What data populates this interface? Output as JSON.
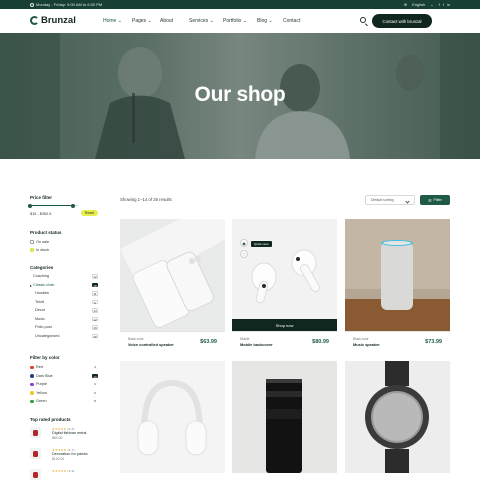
{
  "topbar": {
    "hours": "Monday - Friday: 9:00 AM to 6:00 PM",
    "language": "English",
    "social": [
      "f",
      "t",
      "in"
    ]
  },
  "header": {
    "logo": "Brunzal",
    "nav": [
      "Home",
      "Pages",
      "About",
      "Services",
      "Portfolio",
      "Blog",
      "Contact"
    ],
    "nav_has_dropdown": [
      true,
      true,
      false,
      true,
      true,
      true,
      false
    ],
    "cta": "Contact with brunzal"
  },
  "hero": {
    "title": "Our shop"
  },
  "sidebar": {
    "price_filter": {
      "title": "Price filter",
      "range": "$15 - $350.5",
      "reset": "Reset",
      "range_fraction": [
        0.0,
        0.9
      ]
    },
    "status": {
      "title": "Product status",
      "items": [
        {
          "label": "On sale",
          "checked": false
        },
        {
          "label": "In stock",
          "checked": true
        }
      ]
    },
    "categories": {
      "title": "Categories",
      "items": [
        {
          "label": "Coaching",
          "count": "12",
          "sub": false,
          "active": false
        },
        {
          "label": "Classic chair",
          "count": "18",
          "sub": false,
          "active": true
        },
        {
          "label": "Hoodies",
          "count": "11",
          "sub": true,
          "active": false
        },
        {
          "label": "Tshirt",
          "count": "9",
          "sub": true,
          "active": false
        },
        {
          "label": "Decor",
          "count": "14",
          "sub": true,
          "active": false
        },
        {
          "label": "Music",
          "count": "12",
          "sub": true,
          "active": false
        },
        {
          "label": "Pollo post",
          "count": "16",
          "sub": true,
          "active": false
        },
        {
          "label": "Uncategorized",
          "count": "16",
          "sub": true,
          "active": false
        }
      ]
    },
    "colors": {
      "title": "Filter by color",
      "items": [
        {
          "label": "Red",
          "count": "4",
          "color": "#e23b2e",
          "active": false
        },
        {
          "label": "Dark Blue",
          "count": "10",
          "color": "#2b3a8c",
          "active": true
        },
        {
          "label": "Purple",
          "count": "3",
          "color": "#8a3fd1",
          "active": false
        },
        {
          "label": "Yellow",
          "count": "9",
          "color": "#f2c82c",
          "active": false
        },
        {
          "label": "Green",
          "count": "8",
          "color": "#2e9e4a",
          "active": false
        }
      ]
    },
    "top_rated": {
      "title": "Top rated products",
      "items": [
        {
          "stars": "★★★★★",
          "reviews": "(4.5)",
          "name": "Digital fishtran metal",
          "price": "$60.00"
        },
        {
          "stars": "★★★★★",
          "reviews": "(4.7)",
          "name": "Decoration for panda.",
          "price": "$120.00"
        },
        {
          "stars": "★★★★★",
          "reviews": "(4.9)",
          "name": "",
          "price": ""
        }
      ]
    }
  },
  "toolbar": {
    "results": "Showing 1–14 of 26 results",
    "sort": "Default sorting",
    "filter": "Filter"
  },
  "products": [
    {
      "meta": "Black color",
      "name": "Voice controlled speaker",
      "price": "$63.99",
      "image": "white-phone"
    },
    {
      "meta": "Mobile",
      "name": "Mobile backcover",
      "price": "$80.99",
      "image": "white-earbuds",
      "hover": true,
      "shop_now": "Shop now",
      "quick_view": "Quick view"
    },
    {
      "meta": "Black color",
      "name": "Music speaker",
      "price": "$73.99",
      "image": "smart-speaker"
    },
    {
      "meta": "",
      "name": "",
      "price": "",
      "image": "white-headphones"
    },
    {
      "meta": "",
      "name": "",
      "price": "",
      "image": "camera-lens"
    },
    {
      "meta": "",
      "name": "",
      "price": "",
      "image": "smartwatch"
    }
  ],
  "colors": {
    "primary": "#1f5a44",
    "dark": "#102720",
    "accent": "#e8ee4c",
    "topbar": "#173f33"
  }
}
